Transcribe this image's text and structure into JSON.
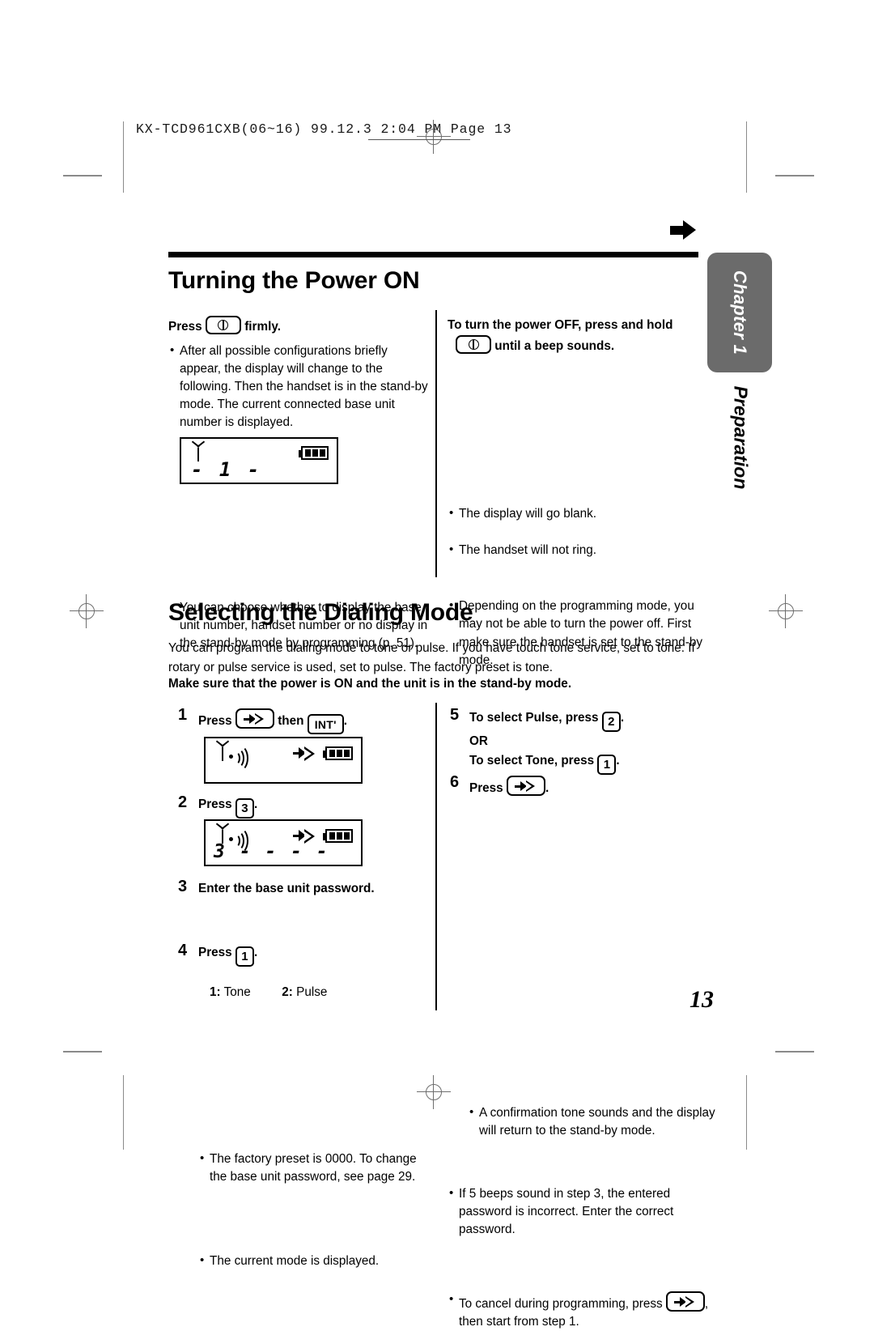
{
  "print_slug": "KX-TCD961CXB(06~16)  99.12.3  2:04 PM  Page 13",
  "page_number": "13",
  "chapter_tab": {
    "chapter": "Chapter 1",
    "part": "Preparation"
  },
  "sections": {
    "power": {
      "heading": "Turning the Power ON",
      "left": {
        "press_prefix": "Press",
        "press_suffix": "firmly.",
        "key_power": "power-key",
        "bullet1": "After all possible configurations briefly appear, the display will change to the following. Then the handset is in the stand-by mode. The current connected base unit number is displayed.",
        "lcd": {
          "line1_icons": [
            "antenna-icon",
            "battery-icon"
          ],
          "line2": "- 1 -"
        },
        "bullet2": "You can choose whether to display the base unit number, handset number or no display in the stand-by mode by programming (p. 51)."
      },
      "right": {
        "off_line1": "To turn the power OFF, press and hold",
        "off_line2": "until a beep sounds.",
        "key_power": "power-key",
        "bullets": [
          "The display will go blank.",
          "The handset will not ring.",
          "Depending on the programming mode, you may not be able to turn the power off. First make sure the handset is set to the stand-by mode."
        ]
      }
    },
    "dialing": {
      "heading": "Selecting the Dialing Mode",
      "intro": "You can program the dialing mode to tone or pulse. If you have touch tone service, set to tone. If rotary or pulse service is used, set to pulse. The factory preset is tone.",
      "intro_bold": "Make sure that the power is ON and the unit is in the stand-by mode.",
      "steps_left": [
        {
          "num": "1",
          "text_before": "Press",
          "text_middle": "then",
          "text_after": ".",
          "keys": [
            "program-key",
            "INT'"
          ]
        },
        {
          "num": "2",
          "text_before": "Press",
          "text_after": ".",
          "keys": [
            "3"
          ]
        },
        {
          "num": "3",
          "text_before": "Enter the base unit password.",
          "bullet": "The factory preset is 0000. To change the base unit password, see page 29."
        },
        {
          "num": "4",
          "text_before": "Press",
          "text_after": ".",
          "keys": [
            "1"
          ],
          "bullet": "The current mode is displayed.",
          "mode_1_label": "1:",
          "mode_1_value": "Tone",
          "mode_2_label": "2:",
          "mode_2_value": "Pulse"
        }
      ],
      "steps_right": [
        {
          "num": "5",
          "line1_before": "To select Pulse, press",
          "line1_key": "2",
          "line1_after": ".",
          "line2": "OR",
          "line3_before": "To select Tone, press",
          "line3_key": "1",
          "line3_after": "."
        },
        {
          "num": "6",
          "text_before": "Press",
          "text_after": ".",
          "keys": [
            "program-key"
          ],
          "bullet": "A confirmation tone sounds and the display will return to the stand-by mode."
        }
      ],
      "right_notes": {
        "note1": "If 5 beeps sound in step 3, the entered password is incorrect. Enter the correct password.",
        "note2_before": "To cancel during programming, press",
        "note2_after": ", then start from step 1."
      },
      "lcd_step1": {
        "line2": ""
      },
      "lcd_step2": {
        "line2": "3 - - - -"
      }
    }
  },
  "colors": {
    "chapter_tab_bg": "#6b6b6b",
    "text": "#000000",
    "mark": "#8a8a8a"
  }
}
